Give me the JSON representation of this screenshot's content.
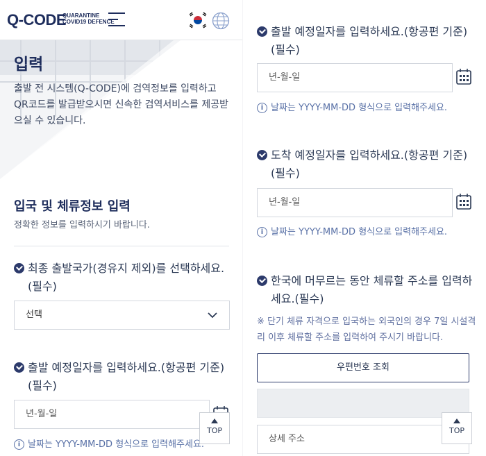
{
  "header": {
    "logo": "Q-CODE",
    "logo_sub_line1": "QUARANTINE",
    "logo_sub_line2": "COVID19 DEFENCE",
    "menu_icon": "hamburger-menu-icon",
    "flag_icon": "korea-flag-icon",
    "globe_icon": "globe-icon"
  },
  "hero": {
    "title": "입력",
    "description": "출발 전 시스템(Q-CODE)에 검역정보를 입력하고 QR코드를 발급받으시면 신속한 검역서비스를 제공받으실 수 있습니다."
  },
  "section": {
    "title": "입국 및 체류정보 입력",
    "subtitle": "정확한 정보를 입력하시기 바랍니다."
  },
  "fields": {
    "departure_country": {
      "label": "최종 출발국가(경유지 제외)를 선택하세요.(필수)",
      "value": "선택"
    },
    "departure_date_left": {
      "label": "출발 예정일자를 입력하세요.(항공편 기준) (필수)",
      "placeholder": "년-월-일",
      "hint": "날짜는 YYYY-MM-DD 형식으로 입력해주세요."
    },
    "departure_date_right": {
      "label": "출발 예정일자를 입력하세요.(항공편 기준) (필수)",
      "placeholder": "년-월-일",
      "hint": "날짜는 YYYY-MM-DD 형식으로 입력해주세요."
    },
    "arrival_date": {
      "label": "도착 예정일자를 입력하세요.(항공편 기준) (필수)",
      "placeholder": "년-월-일",
      "hint": "날짜는 YYYY-MM-DD 형식으로 입력해주세요."
    },
    "address": {
      "label": "한국에 머무르는 동안 체류할 주소를 입력하세요.(필수)",
      "notice": "※ 단기 체류 자격으로 입국하는 외국인의 경우 7일 시설격리 이후 체류할 주소를 입력하여 주시기 바랍니다.",
      "postcode_button": "우편번호 조회",
      "detail_placeholder": "상세 주소"
    }
  },
  "top_button": {
    "label": "TOP"
  },
  "colors": {
    "primary": "#1e2d5c",
    "hint": "#5870a6",
    "border": "#d3d7de"
  }
}
